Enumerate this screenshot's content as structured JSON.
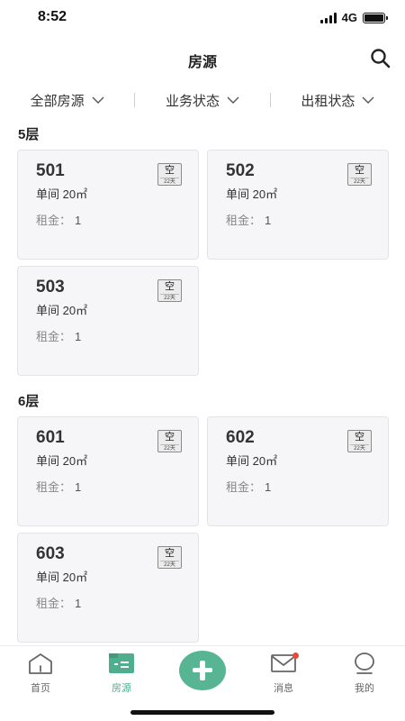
{
  "status": {
    "time": "8:52",
    "network": "4G"
  },
  "nav": {
    "title": "房源"
  },
  "filters": [
    {
      "label": "全部房源"
    },
    {
      "label": "业务状态"
    },
    {
      "label": "出租状态"
    }
  ],
  "floors": [
    {
      "label": "5层",
      "rooms": [
        {
          "number": "501",
          "type": "单间  20㎡",
          "rent_label": "租金：",
          "rent_value": "1",
          "tag": "空",
          "tag_sub": "22天"
        },
        {
          "number": "502",
          "type": "单间  20㎡",
          "rent_label": "租金：",
          "rent_value": "1",
          "tag": "空",
          "tag_sub": "22天"
        },
        {
          "number": "503",
          "type": "单间  20㎡",
          "rent_label": "租金：",
          "rent_value": "1",
          "tag": "空",
          "tag_sub": "22天"
        }
      ]
    },
    {
      "label": "6层",
      "rooms": [
        {
          "number": "601",
          "type": "单间  20㎡",
          "rent_label": "租金：",
          "rent_value": "1",
          "tag": "空",
          "tag_sub": "22天"
        },
        {
          "number": "602",
          "type": "单间  20㎡",
          "rent_label": "租金：",
          "rent_value": "1",
          "tag": "空",
          "tag_sub": "22天"
        },
        {
          "number": "603",
          "type": "单间  20㎡",
          "rent_label": "租金：",
          "rent_value": "1",
          "tag": "空",
          "tag_sub": "22天"
        }
      ]
    }
  ],
  "tabbar": {
    "home": "首页",
    "rooms": "房源",
    "messages": "消息",
    "mine": "我的"
  },
  "colors": {
    "accent": "#58b594",
    "badge": "#e64a3b",
    "card_bg": "#f6f6f9"
  }
}
